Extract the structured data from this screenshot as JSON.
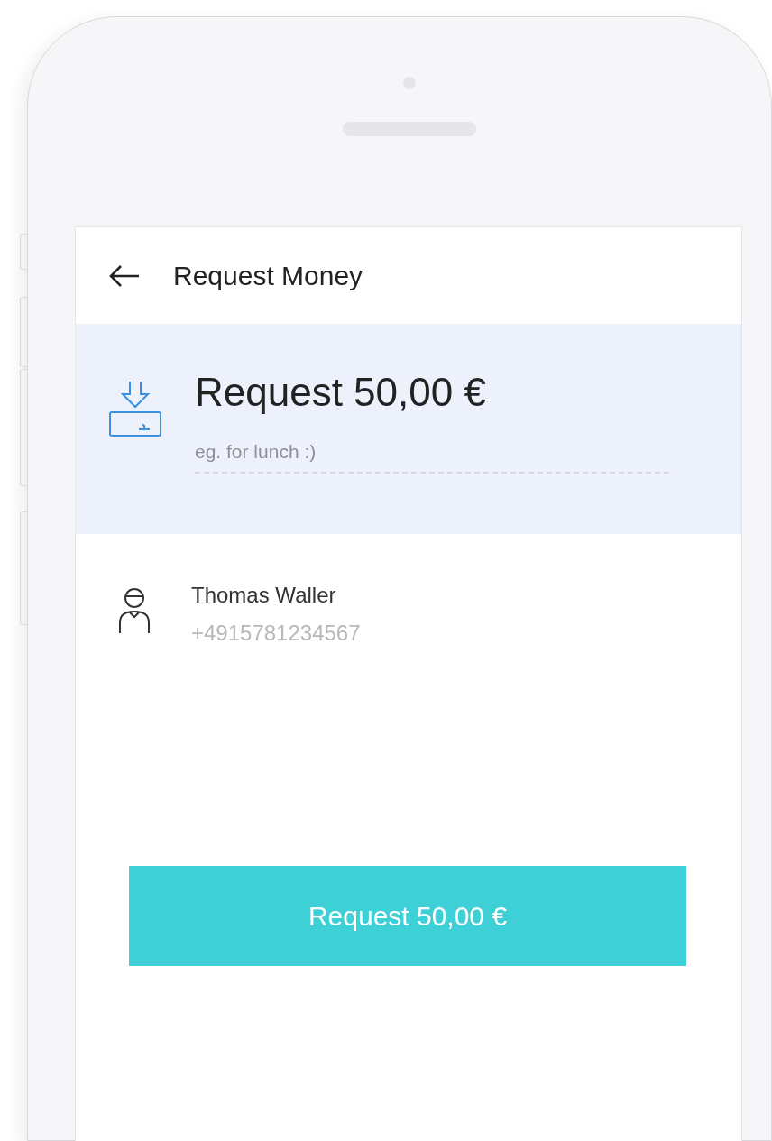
{
  "header": {
    "title": "Request Money"
  },
  "request": {
    "title": "Request 50,00 €",
    "note": {
      "placeholder": "eg. for lunch :)"
    }
  },
  "contact": {
    "name": "Thomas Waller",
    "phone": "+4915781234567"
  },
  "button": {
    "label": "Request 50,00 €"
  }
}
